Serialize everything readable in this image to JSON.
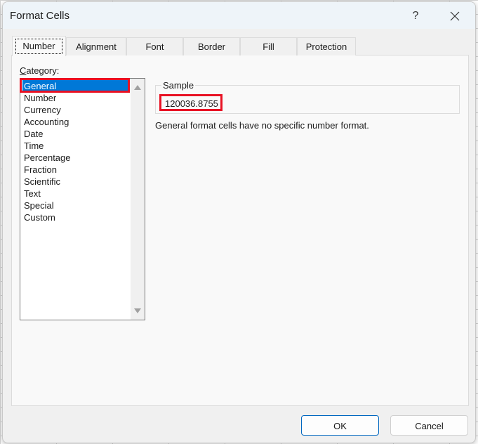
{
  "window": {
    "title": "Format Cells",
    "help_label": "?",
    "close_icon": "close-icon"
  },
  "tabs": [
    {
      "label": "Number",
      "active": true
    },
    {
      "label": "Alignment",
      "active": false
    },
    {
      "label": "Font",
      "active": false
    },
    {
      "label": "Border",
      "active": false
    },
    {
      "label": "Fill",
      "active": false
    },
    {
      "label": "Protection",
      "active": false
    }
  ],
  "category": {
    "label_prefix": "C",
    "label_rest": "ategory:",
    "items": [
      "General",
      "Number",
      "Currency",
      "Accounting",
      "Date",
      "Time",
      "Percentage",
      "Fraction",
      "Scientific",
      "Text",
      "Special",
      "Custom"
    ],
    "selected": "General"
  },
  "sample": {
    "legend": "Sample",
    "value": "120036.8755"
  },
  "description": "General format cells have no specific number format.",
  "buttons": {
    "ok": "OK",
    "cancel": "Cancel"
  },
  "colors": {
    "selection": "#0078d7",
    "highlight_box": "#e81123",
    "primary_border": "#0067c0"
  }
}
